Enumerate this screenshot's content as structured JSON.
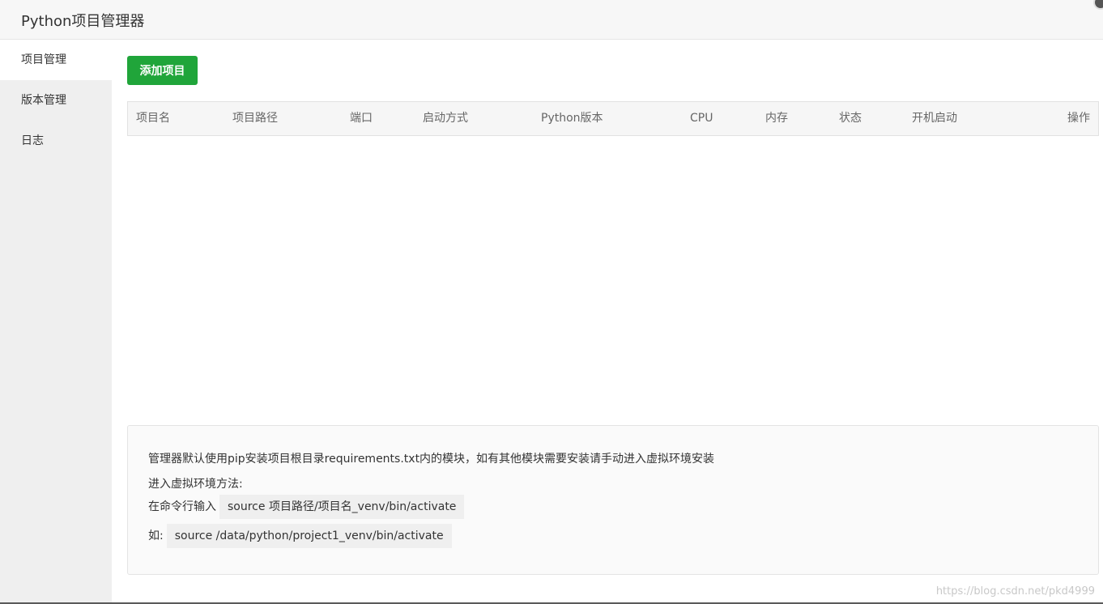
{
  "window": {
    "title": "Python项目管理器"
  },
  "sidebar": {
    "items": [
      {
        "label": "项目管理"
      },
      {
        "label": "版本管理"
      },
      {
        "label": "日志"
      }
    ]
  },
  "toolbar": {
    "add_label": "添加项目"
  },
  "table": {
    "columns": [
      "项目名",
      "项目路径",
      "端口",
      "启动方式",
      "Python版本",
      "CPU",
      "内存",
      "状态",
      "开机启动",
      "操作"
    ],
    "rows": []
  },
  "tips": {
    "line1": "管理器默认使用pip安装项目根目录requirements.txt内的模块，如有其他模块需要安装请手动进入虚拟环境安装",
    "line2": "进入虚拟环境方法:",
    "line3_prefix": "在命令行输入",
    "line3_code": "source 项目路径/项目名_venv/bin/activate",
    "line4_prefix": "如:",
    "line4_code": "source /data/python/project1_venv/bin/activate"
  },
  "watermark": "https://blog.csdn.net/pkd4999",
  "colors": {
    "accent": "#20a53a",
    "sidebar_bg": "#efefef"
  }
}
